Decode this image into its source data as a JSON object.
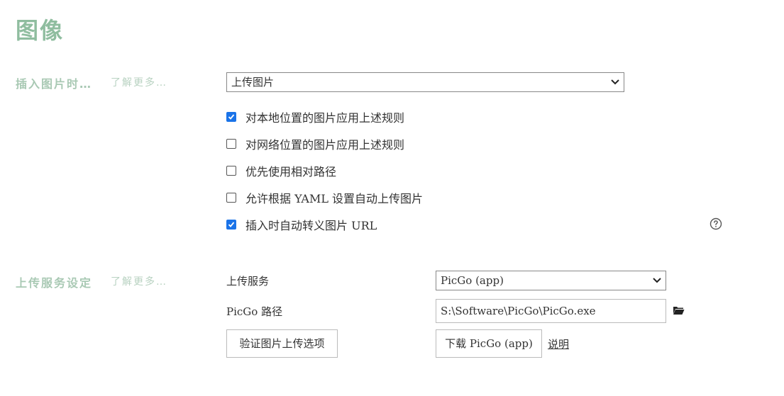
{
  "page": {
    "title": "图像"
  },
  "insert_section": {
    "label": "插入图片时…",
    "learn_more": "了解更多…",
    "action_select": {
      "value": "上传图片"
    },
    "options": [
      {
        "label": "对本地位置的图片应用上述规则",
        "checked": true
      },
      {
        "label": "对网络位置的图片应用上述规则",
        "checked": false
      },
      {
        "label": "优先使用相对路径",
        "checked": false
      },
      {
        "label": "允许根据 YAML 设置自动上传图片",
        "checked": false
      },
      {
        "label": "插入时自动转义图片 URL",
        "checked": true
      }
    ],
    "help_icon": "question-circle-icon"
  },
  "upload_section": {
    "label": "上传服务设定",
    "learn_more": "了解更多…",
    "service_label": "上传服务",
    "service_value": "PicGo (app)",
    "path_label": "PicGo 路径",
    "path_value": "S:\\Software\\PicGo\\PicGo.exe",
    "folder_icon": "folder-icon",
    "verify_button": "验证图片上传选项",
    "download_button": "下载 PicGo (app)",
    "help_link": "说明"
  },
  "colors": {
    "accent_title": "#8fbd9f",
    "section_label": "#a9c9b4",
    "checkbox_checked": "#1a73e8"
  }
}
